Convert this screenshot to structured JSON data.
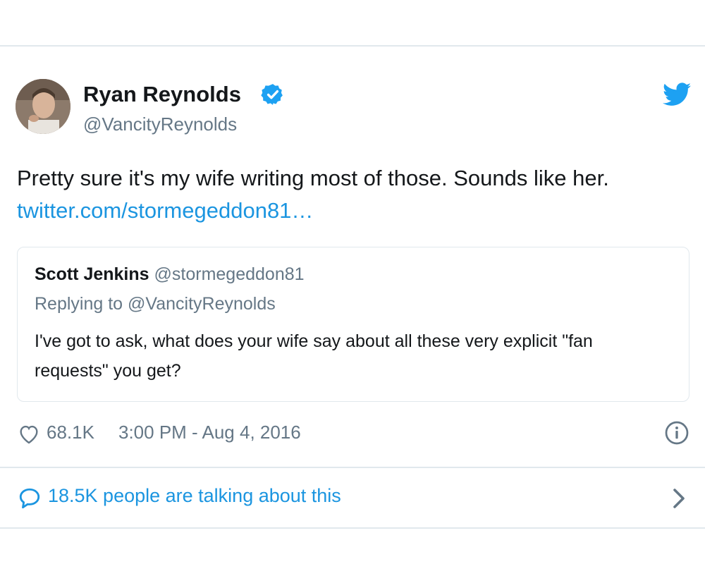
{
  "tweet": {
    "author": {
      "name": "Ryan Reynolds",
      "handle": "@VancityReynolds",
      "verified": true,
      "avatar_icon": "profile-photo"
    },
    "text": "Pretty sure it's my wife writing most of those. Sounds like her.",
    "link": "twitter.com/stormegeddon81…",
    "quoted_tweet": {
      "name": "Scott Jenkins",
      "handle": "@stormegeddon81",
      "replying_to": "Replying to @VancityReynolds",
      "text": "I've got to ask, what does your wife say about all these very explicit \"fan requests\" you get?"
    },
    "likes": "68.1K",
    "timestamp": "3:00 PM - Aug 4, 2016",
    "conversation": "18.5K people are talking about this"
  },
  "icons": {
    "verified": "verified-badge-icon",
    "logo": "twitter-bird-icon",
    "like": "heart-icon",
    "info": "info-icon",
    "replies": "speech-bubble-icon",
    "more": "chevron-right-icon"
  },
  "colors": {
    "accent": "#1da1f2",
    "link": "#1b95e0",
    "text": "#14171a",
    "muted": "#657786",
    "border": "#e1e8ed"
  }
}
